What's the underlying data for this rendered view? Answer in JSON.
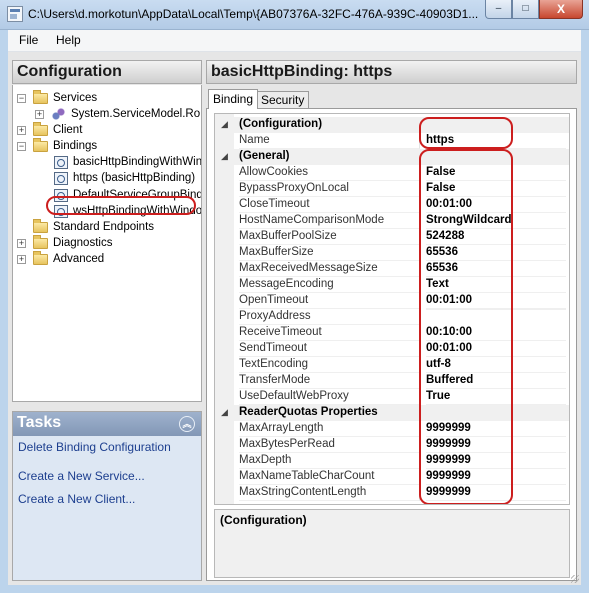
{
  "window": {
    "title": "C:\\Users\\d.morkotun\\AppData\\Local\\Temp\\{AB07376A-32FC-476A-939C-40903D1...",
    "buttons": {
      "minimize": "–",
      "maximize": "□",
      "close": "X"
    }
  },
  "menu": [
    "File",
    "Help"
  ],
  "configuration": {
    "header": "Configuration",
    "tree": [
      {
        "label": "Services",
        "expander": "−",
        "icon": "folder-icon"
      },
      {
        "label": "System.ServiceModel.Ro",
        "expander": "+",
        "icon": "service-icon"
      },
      {
        "label": "Client",
        "expander": "+",
        "icon": "folder-icon"
      },
      {
        "label": "Bindings",
        "expander": "−",
        "icon": "folder-icon"
      },
      {
        "label": "basicHttpBindingWithWin",
        "icon": "binding-icon"
      },
      {
        "label": "https (basicHttpBinding)",
        "icon": "binding-icon",
        "selected": true
      },
      {
        "label": "DefaultServiceGroupBind",
        "icon": "binding-icon"
      },
      {
        "label": "wsHttpBindingWithWindo",
        "icon": "binding-icon"
      },
      {
        "label": "Standard Endpoints",
        "icon": "folder-icon"
      },
      {
        "label": "Diagnostics",
        "expander": "+",
        "icon": "folder-icon"
      },
      {
        "label": "Advanced",
        "expander": "+",
        "icon": "folder-icon"
      }
    ]
  },
  "tasks": {
    "header": "Tasks",
    "collapse_glyph": "︽",
    "links": [
      "Delete Binding Configuration",
      "Create a New Service...",
      "Create a New Client..."
    ]
  },
  "binding": {
    "header": "basicHttpBinding: https",
    "tabs": [
      "Binding",
      "Security"
    ],
    "active_tab": "Binding",
    "grid": [
      {
        "category": "(Configuration)"
      },
      {
        "name": "Name",
        "value": "https"
      },
      {
        "category": "(General)"
      },
      {
        "name": "AllowCookies",
        "value": "False"
      },
      {
        "name": "BypassProxyOnLocal",
        "value": "False"
      },
      {
        "name": "CloseTimeout",
        "value": "00:01:00"
      },
      {
        "name": "HostNameComparisonMode",
        "value": "StrongWildcard"
      },
      {
        "name": "MaxBufferPoolSize",
        "value": "524288"
      },
      {
        "name": "MaxBufferSize",
        "value": "65536"
      },
      {
        "name": "MaxReceivedMessageSize",
        "value": "65536"
      },
      {
        "name": "MessageEncoding",
        "value": "Text"
      },
      {
        "name": "OpenTimeout",
        "value": "00:01:00"
      },
      {
        "name": "ProxyAddress",
        "value": ""
      },
      {
        "name": "ReceiveTimeout",
        "value": "00:10:00"
      },
      {
        "name": "SendTimeout",
        "value": "00:01:00"
      },
      {
        "name": "TextEncoding",
        "value": "utf-8"
      },
      {
        "name": "TransferMode",
        "value": "Buffered"
      },
      {
        "name": "UseDefaultWebProxy",
        "value": "True"
      },
      {
        "category": "ReaderQuotas Properties"
      },
      {
        "name": "MaxArrayLength",
        "value": "9999999"
      },
      {
        "name": "MaxBytesPerRead",
        "value": "9999999"
      },
      {
        "name": "MaxDepth",
        "value": "9999999"
      },
      {
        "name": "MaxNameTableCharCount",
        "value": "9999999"
      },
      {
        "name": "MaxStringContentLength",
        "value": "9999999"
      }
    ],
    "category_toggle": "◢",
    "description_title": "(Configuration)"
  },
  "colors": {
    "highlight": "#cc1e1e",
    "link": "#1d3f8f",
    "tasks_header": "#8fa3c0"
  }
}
